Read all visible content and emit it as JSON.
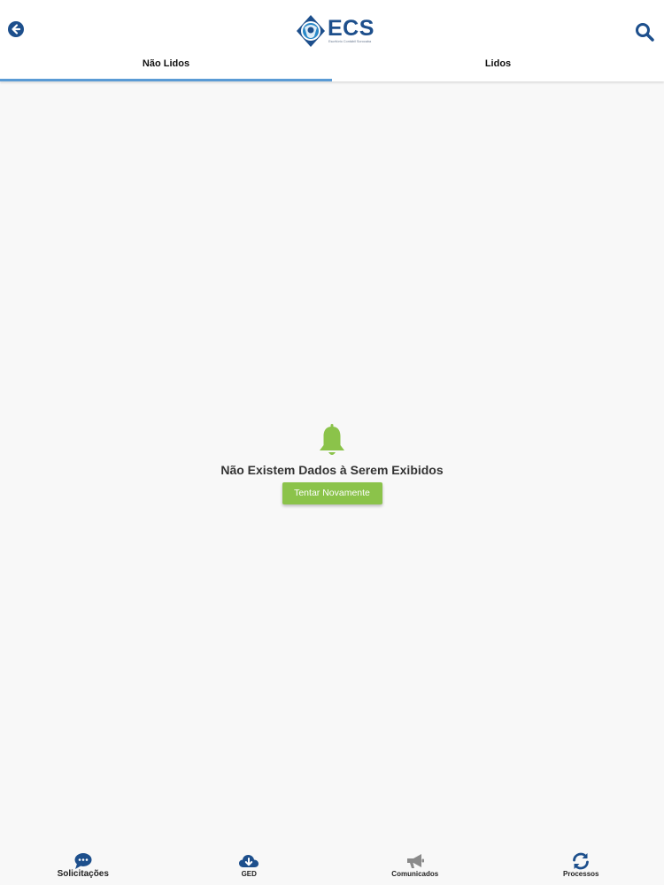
{
  "header": {
    "logo_text": "ECS",
    "logo_subtext": "Escritório Contábil Sorocaba"
  },
  "tabs": [
    {
      "label": "Não Lidos",
      "active": true
    },
    {
      "label": "Lidos",
      "active": false
    }
  ],
  "empty_state": {
    "icon": "bell-icon",
    "message": "Não Existem Dados à Serem Exibidos",
    "retry_label": "Tentar Novamente"
  },
  "bottom_nav": [
    {
      "label": "Solicitações",
      "icon": "chat-bubble-icon",
      "color": "#1d4f8c"
    },
    {
      "label": "GED",
      "icon": "cloud-download-icon",
      "color": "#1d4f8c"
    },
    {
      "label": "Comunicados",
      "icon": "megaphone-icon",
      "color": "#8a8a8a"
    },
    {
      "label": "Processos",
      "icon": "refresh-icon",
      "color": "#1d4f8c"
    }
  ],
  "colors": {
    "brand": "#1d4f8c",
    "tab_indicator": "#5a9bd5",
    "accent_green": "#8bc34a"
  }
}
